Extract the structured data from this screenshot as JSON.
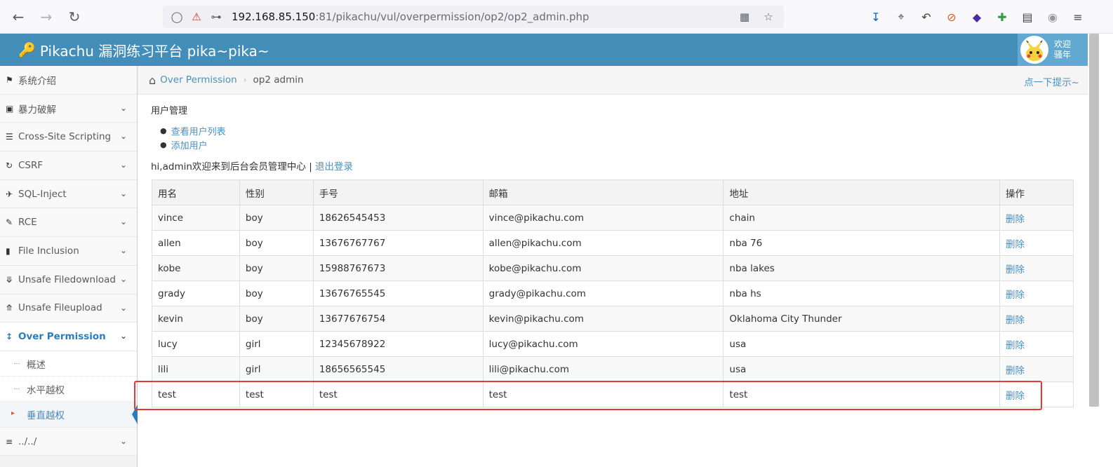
{
  "browser": {
    "url_host": "192.168.85.150",
    "url_rest": ":81/pikachu/vul/overpermission/op2/op2_admin.php"
  },
  "header": {
    "title": "Pikachu 漏洞练习平台 pika~pika~",
    "user_line1": "欢迎",
    "user_line2": "骚年"
  },
  "sidebar": {
    "items": [
      {
        "label": "系统介绍",
        "icon": "tags-icon"
      },
      {
        "label": "暴力破解",
        "icon": "lock-icon"
      },
      {
        "label": "Cross-Site Scripting",
        "icon": "sitemap-icon"
      },
      {
        "label": "CSRF",
        "icon": "refresh-icon"
      },
      {
        "label": "SQL-Inject",
        "icon": "plane-icon"
      },
      {
        "label": "RCE",
        "icon": "pencil-icon"
      },
      {
        "label": "File Inclusion",
        "icon": "file-icon"
      },
      {
        "label": "Unsafe Filedownload",
        "icon": "download-icon"
      },
      {
        "label": "Unsafe Fileupload",
        "icon": "upload-icon"
      },
      {
        "label": "Over Permission",
        "icon": "text-height-icon"
      }
    ],
    "sub_items": [
      "概述",
      "水平越权",
      "垂直越权"
    ],
    "last_item": "../../"
  },
  "breadcrumb": {
    "parent": "Over Permission",
    "current": "op2 admin",
    "hint": "点一下提示~"
  },
  "content": {
    "section_title": "用户管理",
    "links": [
      "查看用户列表",
      "添加用户"
    ],
    "welcome": "hi,admin欢迎来到后台会员管理中心 | ",
    "logout": "退出登录"
  },
  "table": {
    "headers": [
      "用名",
      "性别",
      "手号",
      "邮箱",
      "地址",
      "操作"
    ],
    "rows": [
      [
        "vince",
        "boy",
        "18626545453",
        "vince@pikachu.com",
        "chain",
        "删除"
      ],
      [
        "allen",
        "boy",
        "13676767767",
        "allen@pikachu.com",
        "nba 76",
        "删除"
      ],
      [
        "kobe",
        "boy",
        "15988767673",
        "kobe@pikachu.com",
        "nba lakes",
        "删除"
      ],
      [
        "grady",
        "boy",
        "13676765545",
        "grady@pikachu.com",
        "nba hs",
        "删除"
      ],
      [
        "kevin",
        "boy",
        "13677676754",
        "kevin@pikachu.com",
        "Oklahoma City Thunder",
        "删除"
      ],
      [
        "lucy",
        "girl",
        "12345678922",
        "lucy@pikachu.com",
        "usa",
        "删除"
      ],
      [
        "lili",
        "girl",
        "18656565545",
        "lili@pikachu.com",
        "usa",
        "删除"
      ],
      [
        "test",
        "test",
        "test",
        "test",
        "test",
        "删除"
      ]
    ]
  },
  "colors": {
    "header": "#438eb9",
    "link": "#4c8fbd",
    "highlight": "#e33b33"
  }
}
